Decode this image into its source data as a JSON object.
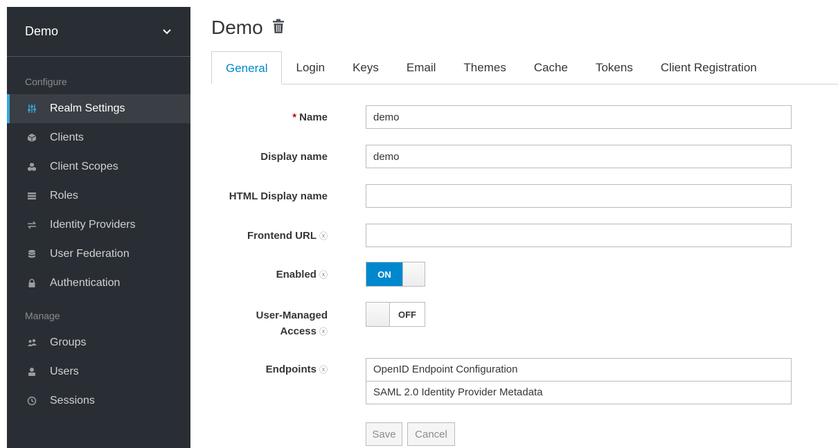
{
  "sidebar": {
    "realm_name": "Demo",
    "realm_chevron": "chevron-down-icon",
    "configure_label": "Configure",
    "configure_items": [
      {
        "label": "Realm Settings",
        "icon": "sliders-icon"
      },
      {
        "label": "Clients",
        "icon": "cube-icon"
      },
      {
        "label": "Client Scopes",
        "icon": "cubes-icon"
      },
      {
        "label": "Roles",
        "icon": "list-icon"
      },
      {
        "label": "Identity Providers",
        "icon": "exchange-icon"
      },
      {
        "label": "User Federation",
        "icon": "database-icon"
      },
      {
        "label": "Authentication",
        "icon": "lock-icon"
      }
    ],
    "manage_label": "Manage",
    "manage_items": [
      {
        "label": "Groups",
        "icon": "users-icon"
      },
      {
        "label": "Users",
        "icon": "user-icon"
      },
      {
        "label": "Sessions",
        "icon": "clock-icon"
      }
    ],
    "accent_color": "#39a5dc"
  },
  "header": {
    "title": "Demo",
    "delete_icon": "trash-icon"
  },
  "tabs": [
    "General",
    "Login",
    "Keys",
    "Email",
    "Themes",
    "Cache",
    "Tokens",
    "Client Registration"
  ],
  "form": {
    "name": {
      "required_mark": "*",
      "label": "Name",
      "value": "demo"
    },
    "display_name": {
      "label": "Display name",
      "value": "demo"
    },
    "html_display_name": {
      "label": "HTML Display name",
      "value": ""
    },
    "frontend_url": {
      "label": "Frontend URL",
      "value": ""
    },
    "enabled": {
      "label": "Enabled",
      "value": "ON"
    },
    "user_managed_access": {
      "label_line1": "User-Managed",
      "label_line2": "Access",
      "value": "OFF"
    },
    "endpoints": {
      "label": "Endpoints",
      "items": [
        "OpenID Endpoint Configuration",
        "SAML 2.0 Identity Provider Metadata"
      ]
    },
    "help_icon": "help-circle-icon",
    "save_label": "Save",
    "cancel_label": "Cancel"
  },
  "colors": {
    "primary": "#0088ce",
    "sidebar_bg": "#292e34"
  }
}
